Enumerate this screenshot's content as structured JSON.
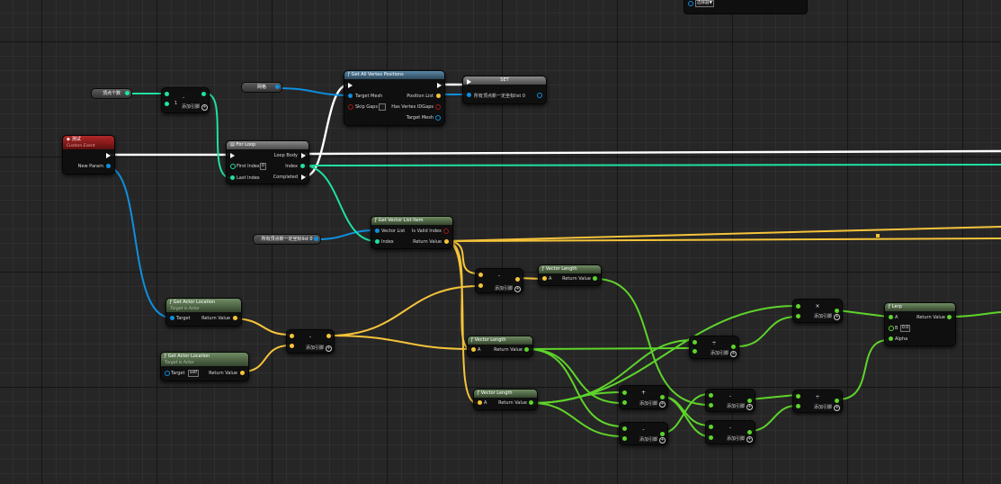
{
  "colors": {
    "exec": "#ffffff",
    "object": "#0f8fde",
    "integer": "#1fe1a4",
    "vector": "#f6c43a",
    "float": "#5ed42b",
    "bool": "#a01717",
    "header_blue": "#4b7896",
    "header_green": "#5f7a55",
    "header_red": "#9e2020"
  },
  "icons": {
    "function": "f-icon",
    "event": "event-icon",
    "loop": "loop-icon",
    "add_pin": "plus-circle-icon"
  },
  "top_node": {
    "dropdown": "选择器▼"
  },
  "vertex_count_var": {
    "label": "顶点个数"
  },
  "mesh_var": {
    "label": "网格"
  },
  "points_var": {
    "label": "所有顶点新一定坐标list 0"
  },
  "minus_int": {
    "op": "-",
    "value": "1",
    "add_pin": "添加引脚"
  },
  "get_all_vertex": {
    "title": "Get All Vertex Positions",
    "pins": [
      "Target Mesh",
      "Skip Gaps",
      "Position List",
      "Has Vertex IDGaps",
      "Target Mesh"
    ]
  },
  "set_node": {
    "title": "SET",
    "var": "所有顶点新一定坐标list 0"
  },
  "event_node": {
    "title": "测试",
    "subtitle": "Custom Event",
    "pin": "New Param"
  },
  "for_loop": {
    "title": "For Loop",
    "pins": [
      "First Index",
      "Last Index",
      "Loop Body",
      "Index",
      "Completed"
    ],
    "first_index_value": "0"
  },
  "get_vector_item": {
    "title": "Get Vector List Item",
    "pins": [
      "Vector List",
      "Index",
      "Is Valid Index",
      "Return Value"
    ]
  },
  "actor_loc_1": {
    "title": "Get Actor Location",
    "subtitle": "Target is Actor",
    "target": "Target",
    "return": "Return Value"
  },
  "actor_loc_2": {
    "title": "Get Actor Location",
    "subtitle": "Target is Actor",
    "target": "Target",
    "target_value": "self",
    "return": "Return Value"
  },
  "sub_vec_1": {
    "op": "-",
    "add_pin": "添加引脚"
  },
  "sub_vec_2": {
    "op": "-",
    "add_pin": "添加引脚"
  },
  "vec_len_1": {
    "title": "Vector Length",
    "a": "A",
    "return": "Return Value"
  },
  "vec_len_2": {
    "title": "Vector Length",
    "a": "A",
    "return": "Return Value"
  },
  "vec_len_3": {
    "title": "Vector Length",
    "a": "A",
    "return": "Return Value"
  },
  "add_f": {
    "op": "+",
    "add_pin": "添加引脚"
  },
  "sub_f_1": {
    "op": "-",
    "add_pin": "添加引脚"
  },
  "sub_f_2": {
    "op": "-",
    "add_pin": "添加引脚"
  },
  "sub_f_3": {
    "op": "-",
    "add_pin": "添加引脚"
  },
  "div_f_1": {
    "op": "÷",
    "add_pin": "添加引脚"
  },
  "div_f_2": {
    "op": "÷",
    "add_pin": "添加引脚"
  },
  "mul_f": {
    "op": "×",
    "add_pin": "添加引脚"
  },
  "lerp": {
    "title": "Lerp",
    "a": "A",
    "b": "B",
    "b_value": "0.0",
    "alpha": "Alpha",
    "return": "Return Value"
  }
}
